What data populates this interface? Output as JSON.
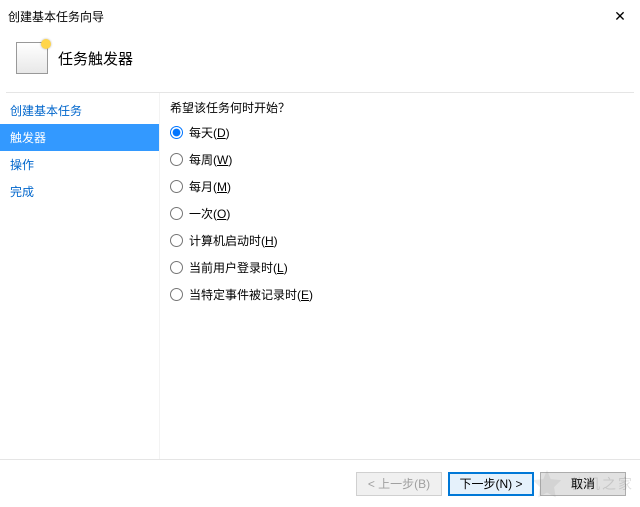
{
  "window": {
    "title": "创建基本任务向导"
  },
  "header": {
    "title": "任务触发器"
  },
  "sidebar": {
    "items": [
      {
        "label": "创建基本任务"
      },
      {
        "label": "触发器"
      },
      {
        "label": "操作"
      },
      {
        "label": "完成"
      }
    ],
    "active_index": 1
  },
  "content": {
    "prompt": "希望该任务何时开始？",
    "options": [
      {
        "label": "每天",
        "hotkey": "D",
        "selected": true
      },
      {
        "label": "每周",
        "hotkey": "W",
        "selected": false
      },
      {
        "label": "每月",
        "hotkey": "M",
        "selected": false
      },
      {
        "label": "一次",
        "hotkey": "O",
        "selected": false
      },
      {
        "label": "计算机启动时",
        "hotkey": "H",
        "selected": false
      },
      {
        "label": "当前用户登录时",
        "hotkey": "L",
        "selected": false
      },
      {
        "label": "当特定事件被记录时",
        "hotkey": "E",
        "selected": false
      }
    ]
  },
  "footer": {
    "back": "< 上一步(B)",
    "next": "下一步(N) >",
    "cancel": "取消"
  },
  "watermark": {
    "text": "装机之家"
  }
}
